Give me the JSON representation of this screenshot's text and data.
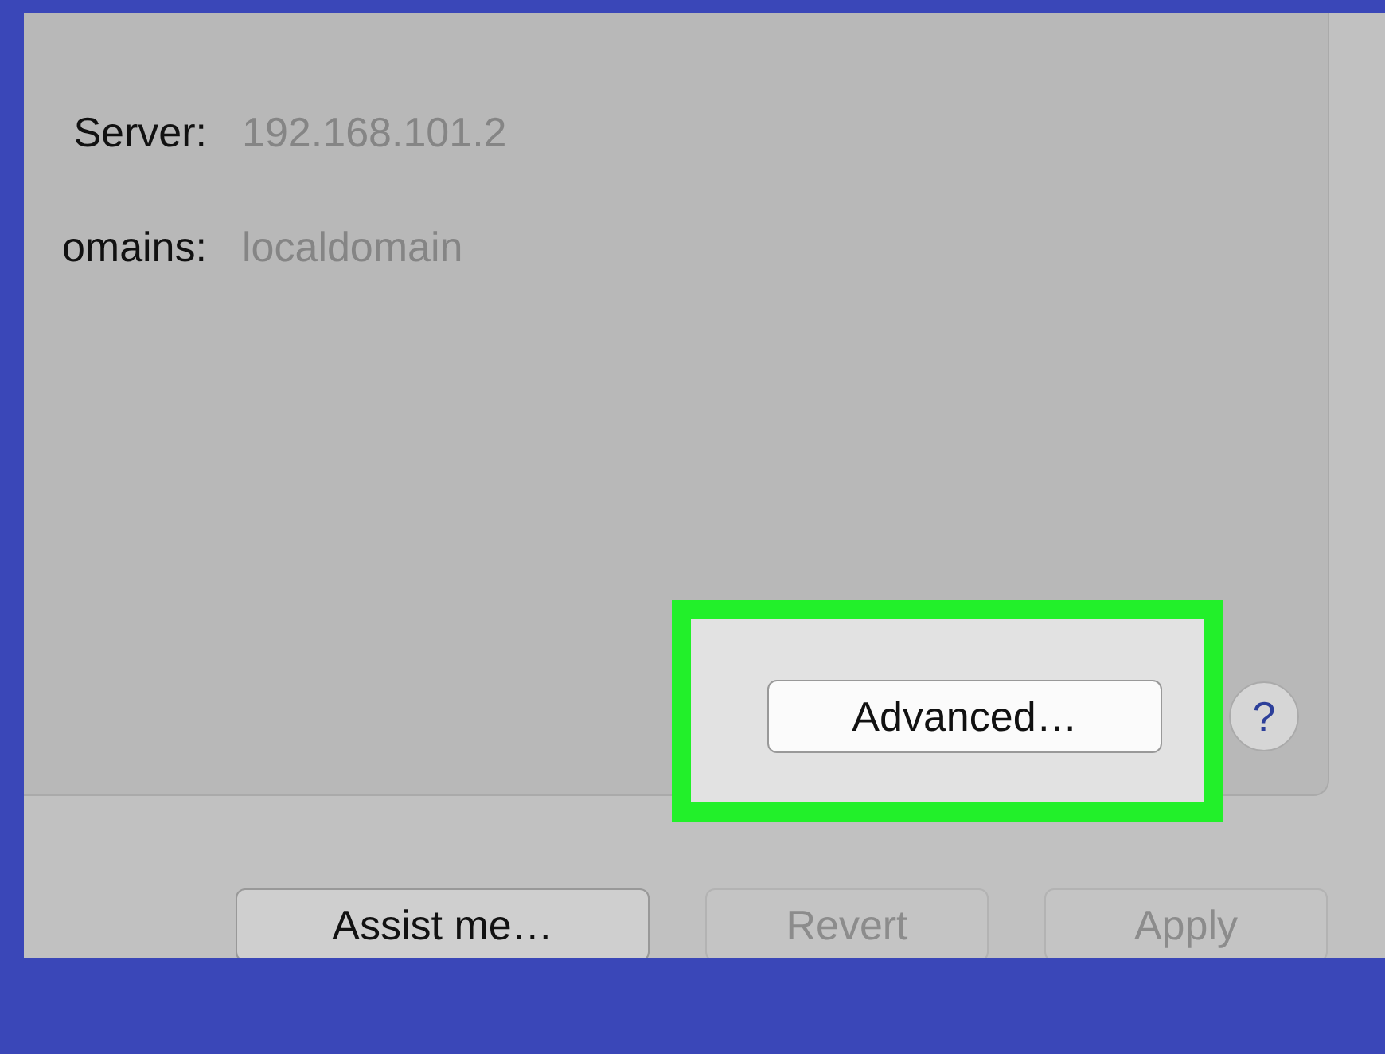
{
  "fields": [
    {
      "label": "Server:",
      "value": "192.168.101.2"
    },
    {
      "label": "omains:",
      "value": "localdomain"
    }
  ],
  "advanced_button": {
    "label": "Advanced…",
    "highlighted": true
  },
  "help_button": {
    "label": "?"
  },
  "buttons": [
    {
      "label": "Assist me…",
      "disabled": false
    },
    {
      "label": "Revert",
      "disabled": true
    },
    {
      "label": "Apply",
      "disabled": true
    }
  ]
}
